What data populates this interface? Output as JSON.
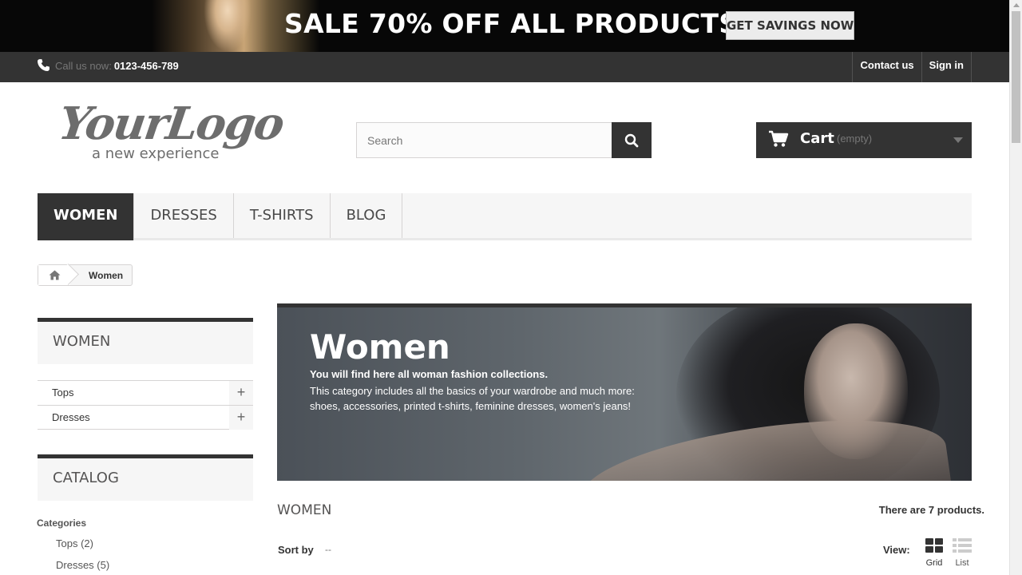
{
  "promo": {
    "text": "SALE 70% OFF ALL PRODUCTS",
    "button_label": "GET SAVINGS NOW"
  },
  "topnav": {
    "call_label": "Call us now:",
    "phone": "0123-456-789",
    "links": [
      "Contact us",
      "Sign in"
    ]
  },
  "logo": {
    "main": "YourLogo",
    "tagline": "a new experience"
  },
  "search": {
    "placeholder": "Search"
  },
  "cart": {
    "label": "Cart",
    "status": "(empty)"
  },
  "menu": {
    "items": [
      "WOMEN",
      "DRESSES",
      "T-SHIRTS",
      "BLOG"
    ],
    "active": "WOMEN"
  },
  "breadcrumb": {
    "current": "Women"
  },
  "sidebar": {
    "women_title": "WOMEN",
    "categories": [
      "Tops",
      "Dresses"
    ],
    "catalog_title": "CATALOG",
    "filter_heading": "Categories",
    "filter_items": [
      "Tops (2)",
      "Dresses (5)"
    ]
  },
  "banner": {
    "title": "Women",
    "lead": "You will find here all woman fashion collections.",
    "description": "This category includes all the basics of your wardrobe and much more: shoes, accessories, printed t-shirts, feminine dresses, women's jeans!"
  },
  "listing": {
    "title": "WOMEN",
    "count_text": "There are 7 products.",
    "sort_label": "Sort by",
    "sort_value": "--",
    "view_label": "View:",
    "view_grid": "Grid",
    "view_list": "List"
  },
  "colors": {
    "dark": "#333333",
    "panel": "#f6f6f6",
    "border": "#d6d4d4"
  }
}
